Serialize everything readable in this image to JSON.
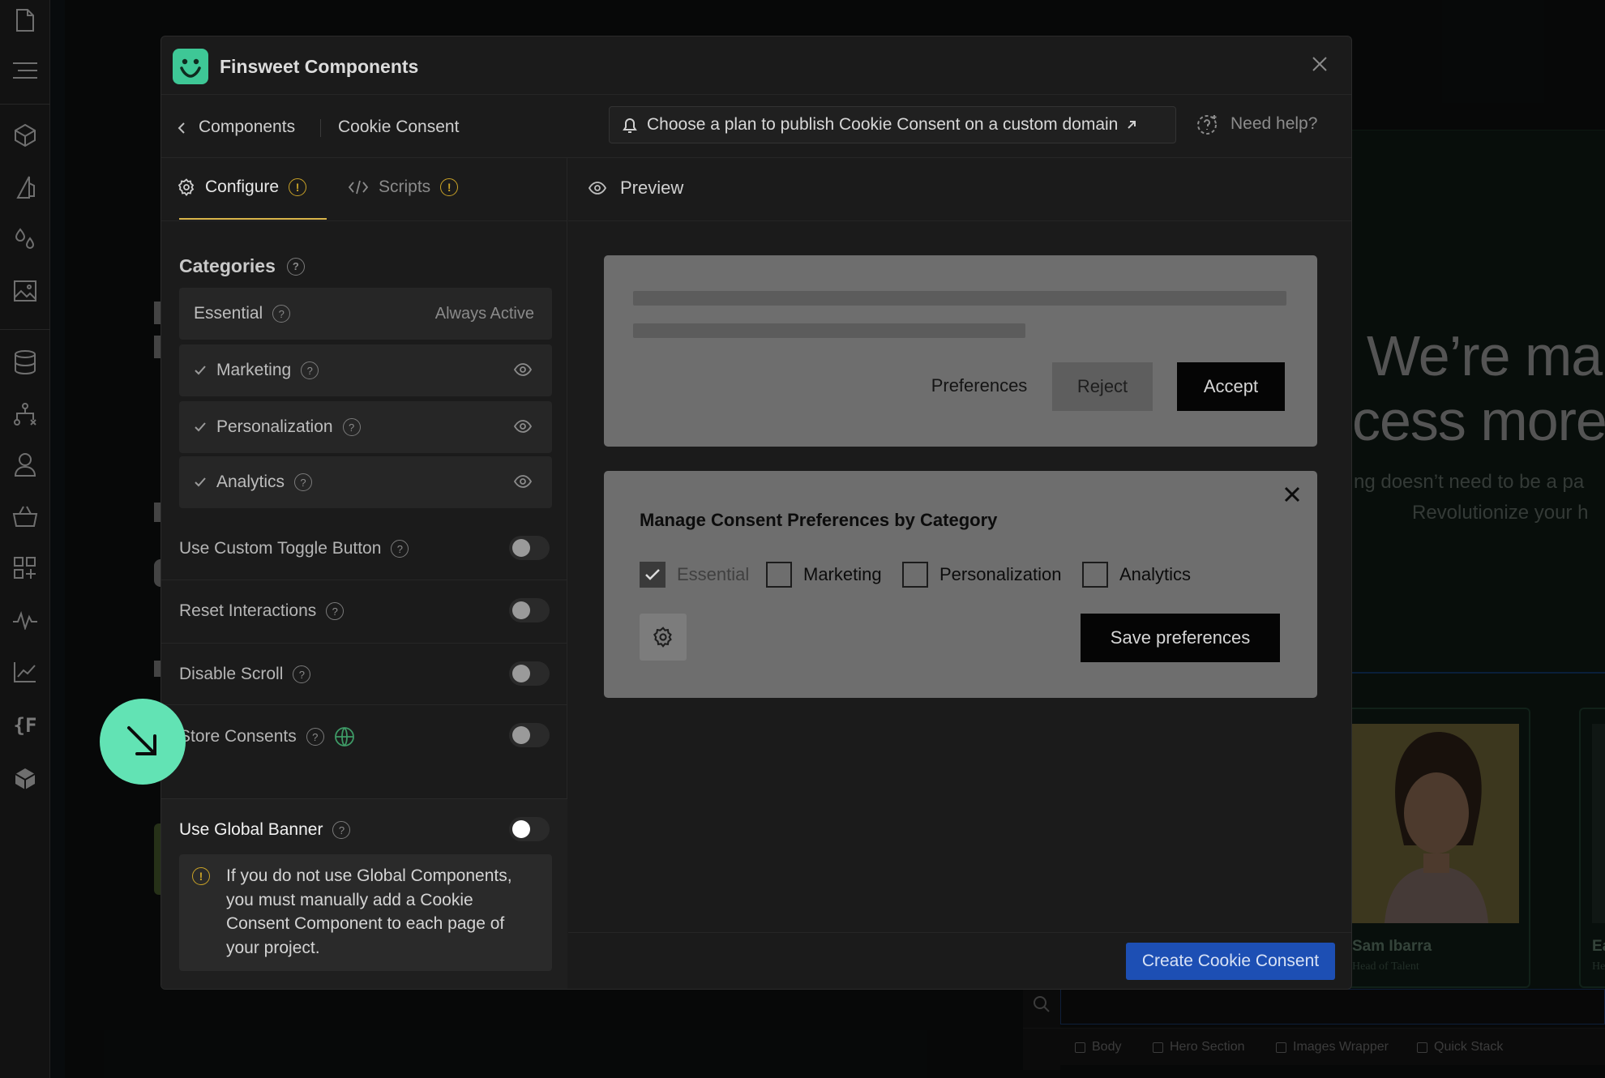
{
  "modal": {
    "title": "Finsweet Components",
    "breadcrumb_back": "Components",
    "breadcrumb_current": "Cookie Consent",
    "plan_banner": "Choose a plan to publish Cookie Consent on a custom domain",
    "help": "Need help?"
  },
  "tabs": {
    "configure": "Configure",
    "scripts": "Scripts",
    "warn_mark": "!"
  },
  "config": {
    "categories_title": "Categories",
    "help_mark": "?",
    "essential": "Essential",
    "always_active": "Always Active",
    "categories": [
      {
        "label": "Marketing",
        "checked": true
      },
      {
        "label": "Personalization",
        "checked": true
      },
      {
        "label": "Analytics",
        "checked": true
      }
    ],
    "options": [
      {
        "label": "Use Custom Toggle Button",
        "on": false
      },
      {
        "label": "Reset Interactions",
        "on": false
      },
      {
        "label": "Disable Scroll",
        "on": false
      },
      {
        "label": "Store Consents",
        "on": false
      }
    ],
    "global_banner": {
      "label": "Use Global Banner",
      "on": false,
      "info": "If you do not use Global Components, you must manually add a Cookie Consent Component to each page of your project."
    }
  },
  "preview": {
    "title": "Preview",
    "banner": {
      "preferences": "Preferences",
      "reject": "Reject",
      "accept": "Accept"
    },
    "prefs_panel": {
      "title": "Manage Consent Preferences by Category",
      "checkboxes": [
        {
          "label": "Essential",
          "checked": true,
          "disabled": true
        },
        {
          "label": "Marketing",
          "checked": false
        },
        {
          "label": "Personalization",
          "checked": false
        },
        {
          "label": "Analytics",
          "checked": false
        }
      ],
      "save": "Save preferences"
    },
    "create_button": "Create Cookie Consent"
  },
  "background_page": {
    "hero_line1": "We’re ma",
    "hero_line2": "cess more",
    "sub_line1": "ng doesn’t need to be a pa",
    "sub_line2": "Revolutionize your h",
    "person1_name": "Sam Ibarra",
    "person1_role": "Head of Talent",
    "person2_name": "Ea",
    "person2_role": "He",
    "more_menu": "···",
    "breadcrumbs": [
      "Body",
      "Hero Section",
      "Images Wrapper",
      "Quick Stack"
    ]
  },
  "left_toolbar": {
    "f_glyph": "{F"
  },
  "colors": {
    "brand_green": "#3ec796",
    "accent_blue": "#1d4fb4",
    "warning": "#c9a227",
    "fab": "#62e3b4"
  }
}
